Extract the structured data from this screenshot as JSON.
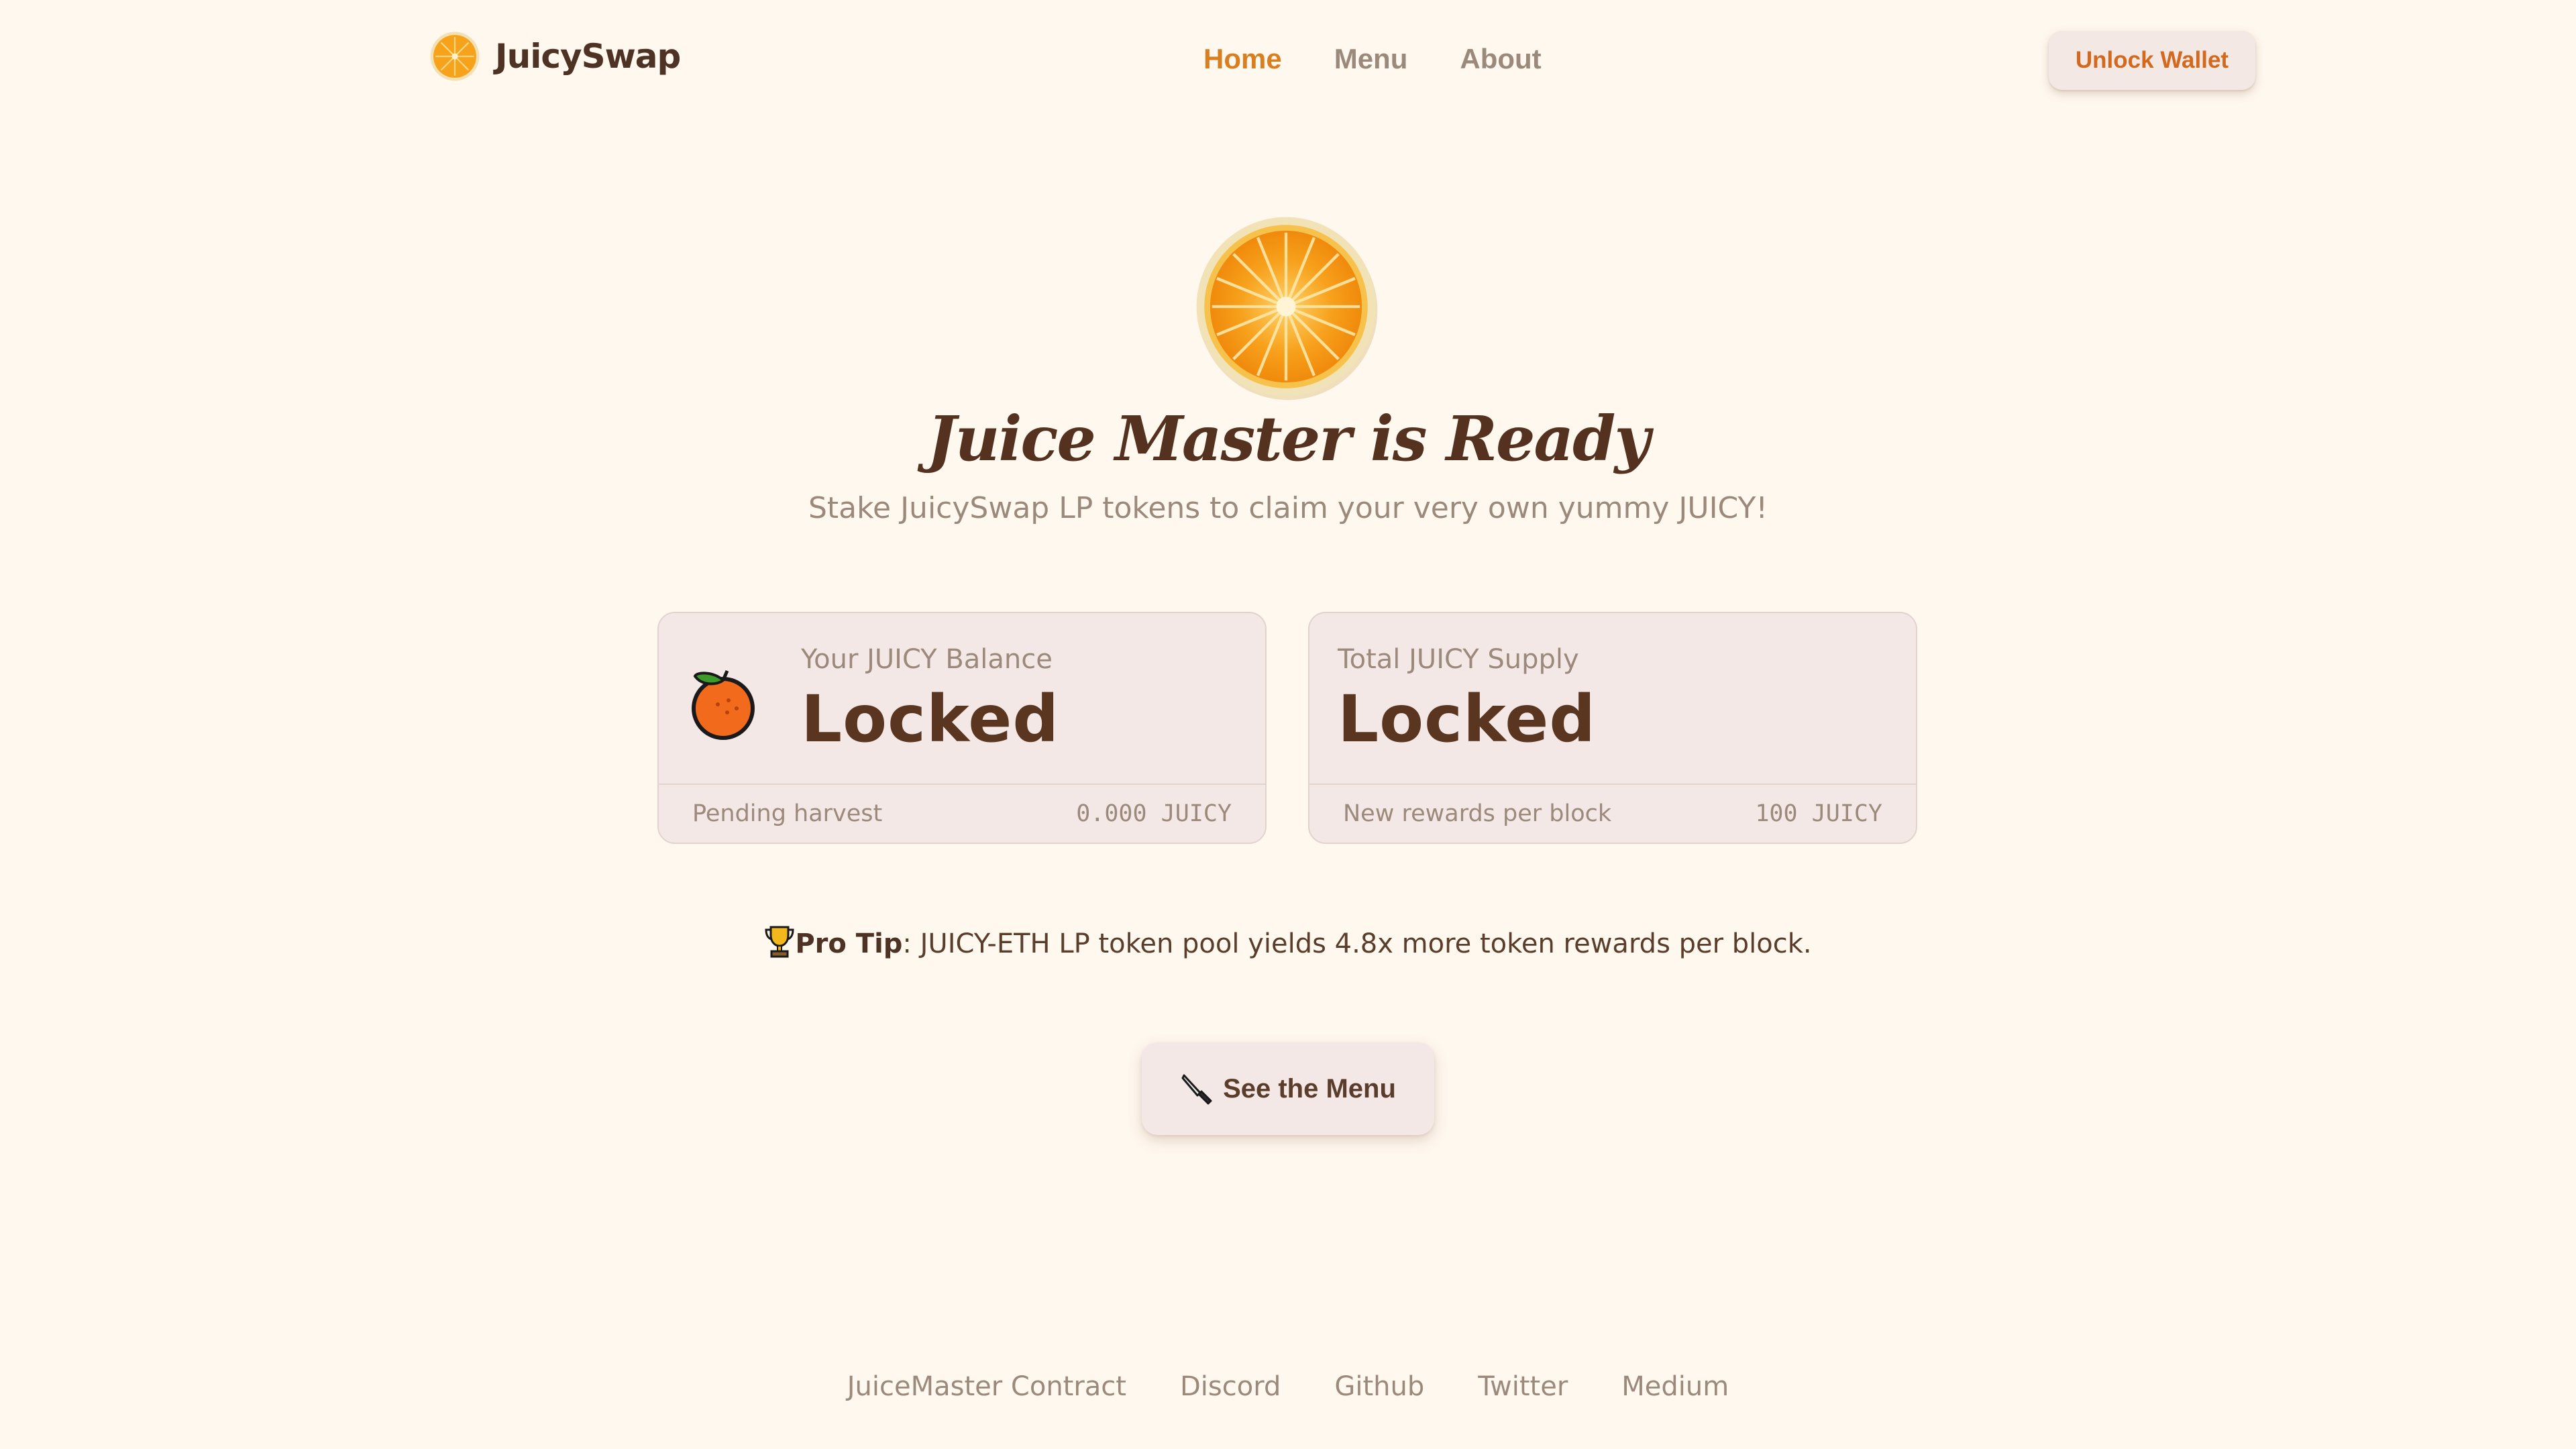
{
  "header": {
    "logo_text": "JuicySwap",
    "logo_icon": "orange-slice-icon",
    "nav": [
      {
        "label": "Home",
        "active": true
      },
      {
        "label": "Menu",
        "active": false
      },
      {
        "label": "About",
        "active": false
      }
    ],
    "unlock_label": "Unlock Wallet"
  },
  "hero": {
    "icon": "orange-slice-icon",
    "title": "Juice Master is Ready",
    "subtitle": "Stake JuicySwap LP tokens to claim your very own yummy JUICY!"
  },
  "cards": {
    "balance": {
      "icon": "orange-fruit-icon",
      "label": "Your JUICY Balance",
      "value": "Locked",
      "footer_label": "Pending harvest",
      "footer_value": "0.000 JUICY"
    },
    "supply": {
      "label": "Total JUICY Supply",
      "value": "Locked",
      "footer_label": "New rewards per block",
      "footer_value": "100 JUICY"
    }
  },
  "pro_tip": {
    "icon": "trophy-icon",
    "label": "Pro Tip",
    "text": ": JUICY-ETH LP token pool yields 4.8x more token rewards per block."
  },
  "menu_button": {
    "icon": "knife-icon",
    "label": "See the Menu"
  },
  "footer_links": [
    "JuiceMaster Contract",
    "Discord",
    "Github",
    "Twitter",
    "Medium"
  ],
  "colors": {
    "background": "#fff8ef",
    "accent": "#d97f1f",
    "text_dark": "#4e3224",
    "text_muted": "#9b8a7b",
    "card_bg": "#f3e8e6"
  }
}
